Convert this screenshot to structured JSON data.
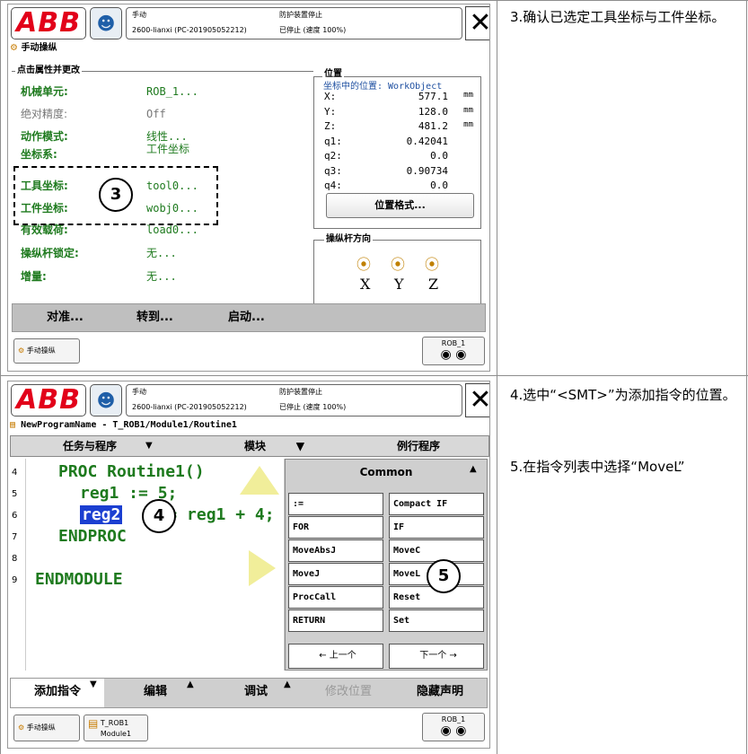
{
  "app": {
    "logo": "ABB",
    "user_icon": "user-info-icon",
    "close_glyph": "✕"
  },
  "status": {
    "mode": "手动",
    "controller": "2600-lianxi (PC-201905052212)",
    "guard": "防护装置停止",
    "run": "已停止 (速度 100%)"
  },
  "jog": {
    "window_title": "手动操纵",
    "group_label": "点击属性并更改",
    "rows": [
      {
        "name": "机械单元:",
        "value": "ROB_1...",
        "muted": false
      },
      {
        "name": "绝对精度:",
        "value": "Off",
        "muted": true
      },
      {
        "name": "动作模式:",
        "value": "线性...",
        "muted": false
      },
      {
        "name": "坐标系:",
        "value": "工件坐标",
        "muted": false
      },
      {
        "name": "工具坐标:",
        "value": "tool0...",
        "muted": false
      },
      {
        "name": "工件坐标:",
        "value": "wobj0...",
        "muted": false
      },
      {
        "name": "有效载荷:",
        "value": "load0...",
        "muted": false
      },
      {
        "name": "操纵杆锁定:",
        "value": "无...",
        "muted": false
      },
      {
        "name": "增量:",
        "value": "无...",
        "muted": false
      }
    ],
    "position": {
      "label": "位置",
      "frame_label": "坐标中的位置: WorkObject",
      "values": [
        {
          "axis": "X:",
          "value": "577.1",
          "unit": "mm"
        },
        {
          "axis": "Y:",
          "value": "128.0",
          "unit": "mm"
        },
        {
          "axis": "Z:",
          "value": "481.2",
          "unit": "mm"
        },
        {
          "axis": "q1:",
          "value": "0.42041",
          "unit": ""
        },
        {
          "axis": "q2:",
          "value": "0.0",
          "unit": ""
        },
        {
          "axis": "q3:",
          "value": "0.90734",
          "unit": ""
        },
        {
          "axis": "q4:",
          "value": "0.0",
          "unit": ""
        }
      ],
      "format_button": "位置格式..."
    },
    "joystick": {
      "label": "操纵杆方向",
      "axes": [
        "X",
        "Y",
        "Z"
      ]
    },
    "bottom_buttons": [
      "对准...",
      "转到...",
      "启动..."
    ],
    "task_button": "手动操纵",
    "rob_label": "ROB_1",
    "step_number": "3"
  },
  "editor": {
    "path": "NewProgramName - T_ROB1/Module1/Routine1",
    "tabs": [
      "任务与程序",
      "模块",
      "例行程序"
    ],
    "lines": [
      {
        "num": "4",
        "text": "PROC Routine1()"
      },
      {
        "num": "5",
        "text": "reg1 := 5;"
      },
      {
        "num": "6",
        "text": "reg2",
        "rest": "= reg1 + 4;"
      },
      {
        "num": "7",
        "text": "ENDPROC"
      },
      {
        "num": "8",
        "text": ""
      },
      {
        "num": "9",
        "text": "ENDMODULE"
      }
    ],
    "panel_title": "Common",
    "instructions": [
      ":=",
      "Compact IF",
      "FOR",
      "IF",
      "MoveAbsJ",
      "MoveC",
      "MoveJ",
      "MoveL",
      "ProcCall",
      "Reset",
      "RETURN",
      "Set"
    ],
    "prev": "← 上一个",
    "next": "下一个 →",
    "bottom_buttons": [
      "添加指令",
      "编辑",
      "调试",
      "修改位置",
      "隐藏声明"
    ],
    "task_buttons": [
      "手动操纵",
      "T_ROB1 Module1"
    ],
    "rob_label": "ROB_1",
    "step_a": "4",
    "step_b": "5"
  },
  "captions": {
    "top": "3.确认已选定工具坐标与工件坐标。",
    "bottom_1": "4.选中“<SMT>”为添加指令的位置。",
    "bottom_2": "5.在指令列表中选择“MoveL”"
  }
}
